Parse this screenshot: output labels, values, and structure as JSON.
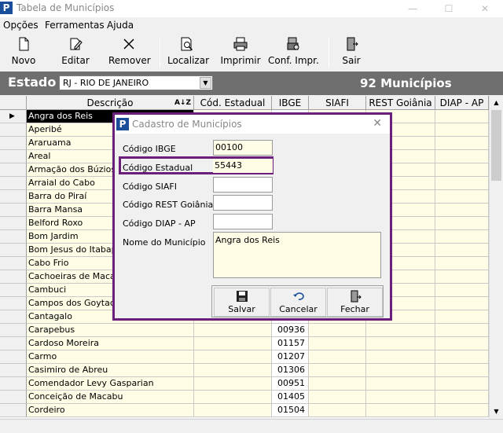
{
  "window": {
    "title": "Tabela de Municípios",
    "app_icon": "P"
  },
  "menu": [
    "Opções",
    "Ferramentas",
    "Ajuda"
  ],
  "toolbar": {
    "novo": "Novo",
    "editar": "Editar",
    "remover": "Remover",
    "localizar": "Localizar",
    "imprimir": "Imprimir",
    "conf": "Conf. Impr.",
    "sair": "Sair"
  },
  "estado": {
    "label": "Estado",
    "selected": "RJ - RIO DE JANEIRO",
    "count": "92 Municípios"
  },
  "grid": {
    "headers": {
      "descricao": "Descrição",
      "cod": "Cód. Estadual",
      "ibge": "IBGE",
      "siafi": "SIAFI",
      "rest": "REST Goiânia",
      "diap": "DIAP - AP"
    },
    "rows": [
      {
        "desc": "Angra dos Reis",
        "ibge": ""
      },
      {
        "desc": "Aperibé",
        "ibge": ""
      },
      {
        "desc": "Araruama",
        "ibge": ""
      },
      {
        "desc": "Areal",
        "ibge": ""
      },
      {
        "desc": "Armação dos Búzios",
        "ibge": ""
      },
      {
        "desc": "Arraial do Cabo",
        "ibge": ""
      },
      {
        "desc": "Barra do Piraí",
        "ibge": ""
      },
      {
        "desc": "Barra Mansa",
        "ibge": ""
      },
      {
        "desc": "Belford Roxo",
        "ibge": ""
      },
      {
        "desc": "Bom Jardim",
        "ibge": ""
      },
      {
        "desc": "Bom Jesus do Itabapoana",
        "ibge": ""
      },
      {
        "desc": "Cabo Frio",
        "ibge": ""
      },
      {
        "desc": "Cachoeiras de Macacu",
        "ibge": ""
      },
      {
        "desc": "Cambuci",
        "ibge": ""
      },
      {
        "desc": "Campos dos Goytacazes",
        "ibge": ""
      },
      {
        "desc": "Cantagalo",
        "ibge": ""
      },
      {
        "desc": "Carapebus",
        "ibge": "00936"
      },
      {
        "desc": "Cardoso Moreira",
        "ibge": "01157"
      },
      {
        "desc": "Carmo",
        "ibge": "01207"
      },
      {
        "desc": "Casimiro de Abreu",
        "ibge": "01306"
      },
      {
        "desc": "Comendador Levy Gasparian",
        "ibge": "00951"
      },
      {
        "desc": "Conceição de Macabu",
        "ibge": "01405"
      },
      {
        "desc": "Cordeiro",
        "ibge": "01504"
      }
    ]
  },
  "dialog": {
    "title": "Cadastro de Municípios",
    "labels": {
      "ibge": "Código IBGE",
      "estadual": "Código Estadual",
      "siafi": "Código SIAFI",
      "rest": "Código REST Goiânia",
      "diap": "Código DIAP - AP",
      "nome": "Nome do Município"
    },
    "values": {
      "ibge": "00100",
      "estadual": "55443",
      "siafi": "",
      "rest": "",
      "diap": "",
      "nome": "Angra dos Reis"
    },
    "buttons": {
      "salvar": "Salvar",
      "cancelar": "Cancelar",
      "fechar": "Fechar"
    }
  },
  "colors": {
    "highlight": "#6b1f7b",
    "estado_bar": "#6e6e6e",
    "cell_yellow": "#fffde6"
  }
}
